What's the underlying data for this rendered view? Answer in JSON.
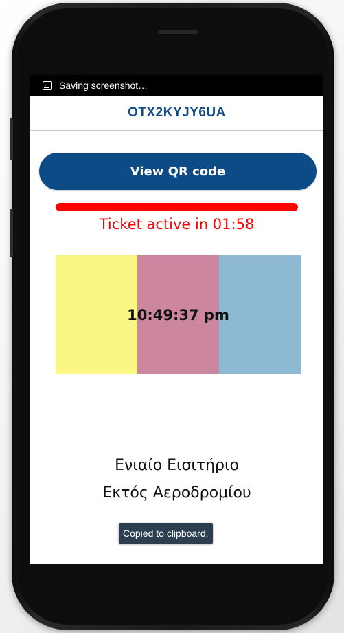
{
  "statusbar": {
    "icon": "screenshot-icon",
    "text": "Saving screenshot…"
  },
  "header": {
    "code": "OTX2KYJY6UA"
  },
  "qr_button": {
    "label": "View QR code"
  },
  "activation": {
    "progress_fraction": 1.0,
    "text": "Ticket active in 01:58",
    "color": "#ff0000"
  },
  "time_display": {
    "clock": "10:49:37 pm",
    "stripe_colors": [
      "#fbf784",
      "#cd86a0",
      "#8dbad2"
    ]
  },
  "ticket": {
    "line1": "Ενιαίο Εισιτήριο",
    "line2": "Εκτός Αεροδρομίου"
  },
  "toast": {
    "text": "Copied to clipboard."
  },
  "colors": {
    "brand_blue": "#0d4b87",
    "alert_red": "#ff0000"
  }
}
